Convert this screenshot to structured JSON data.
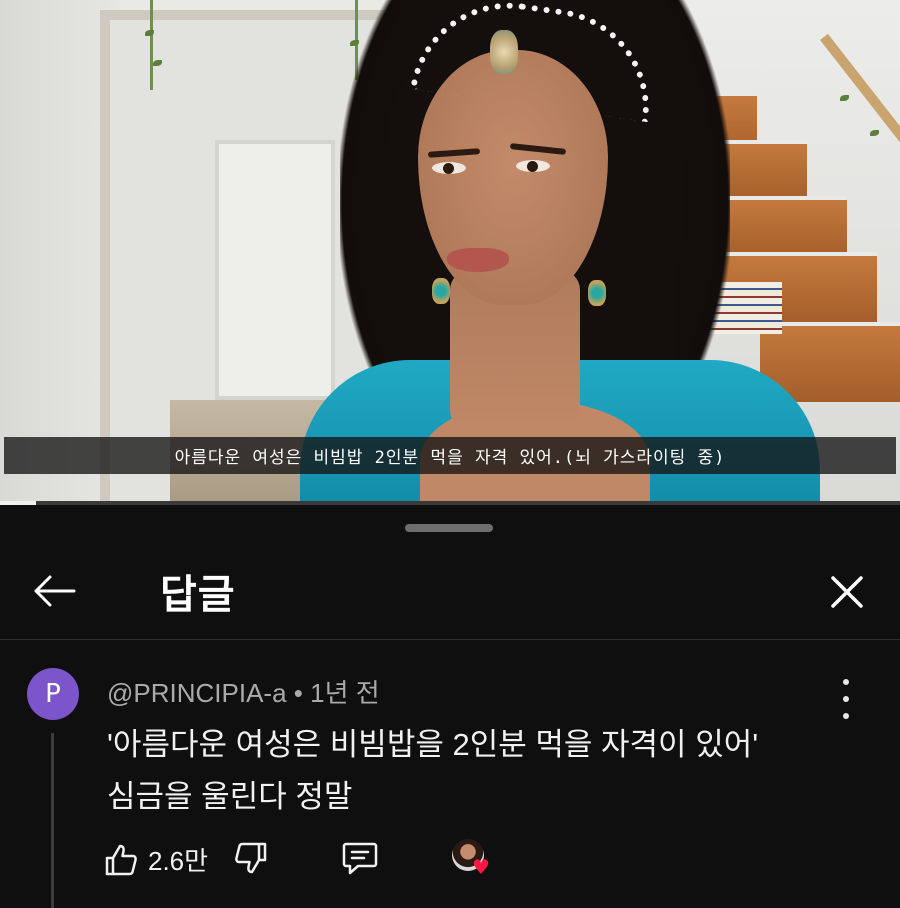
{
  "video": {
    "subtitle": "아름다운 여성은 비빔밥 2인분 먹을 자격 있어.(뇌 가스라이팅 중)",
    "progress_fraction": 0.04
  },
  "panel": {
    "title": "답글",
    "back_icon": "arrow-left-icon",
    "close_icon": "close-icon"
  },
  "comment": {
    "avatar_letter": "P",
    "avatar_color": "#7b55c9",
    "author": "@PRINCIPIA-a",
    "separator": " • ",
    "time": "1년 전",
    "text_line1": "'아름다운 여성은 비빔밥을 2인분 먹을 자격이 있어'",
    "text_line2": "심금을 울린다 정말",
    "like_count": "2.6만",
    "creator_heart_color": "#ff1744"
  }
}
